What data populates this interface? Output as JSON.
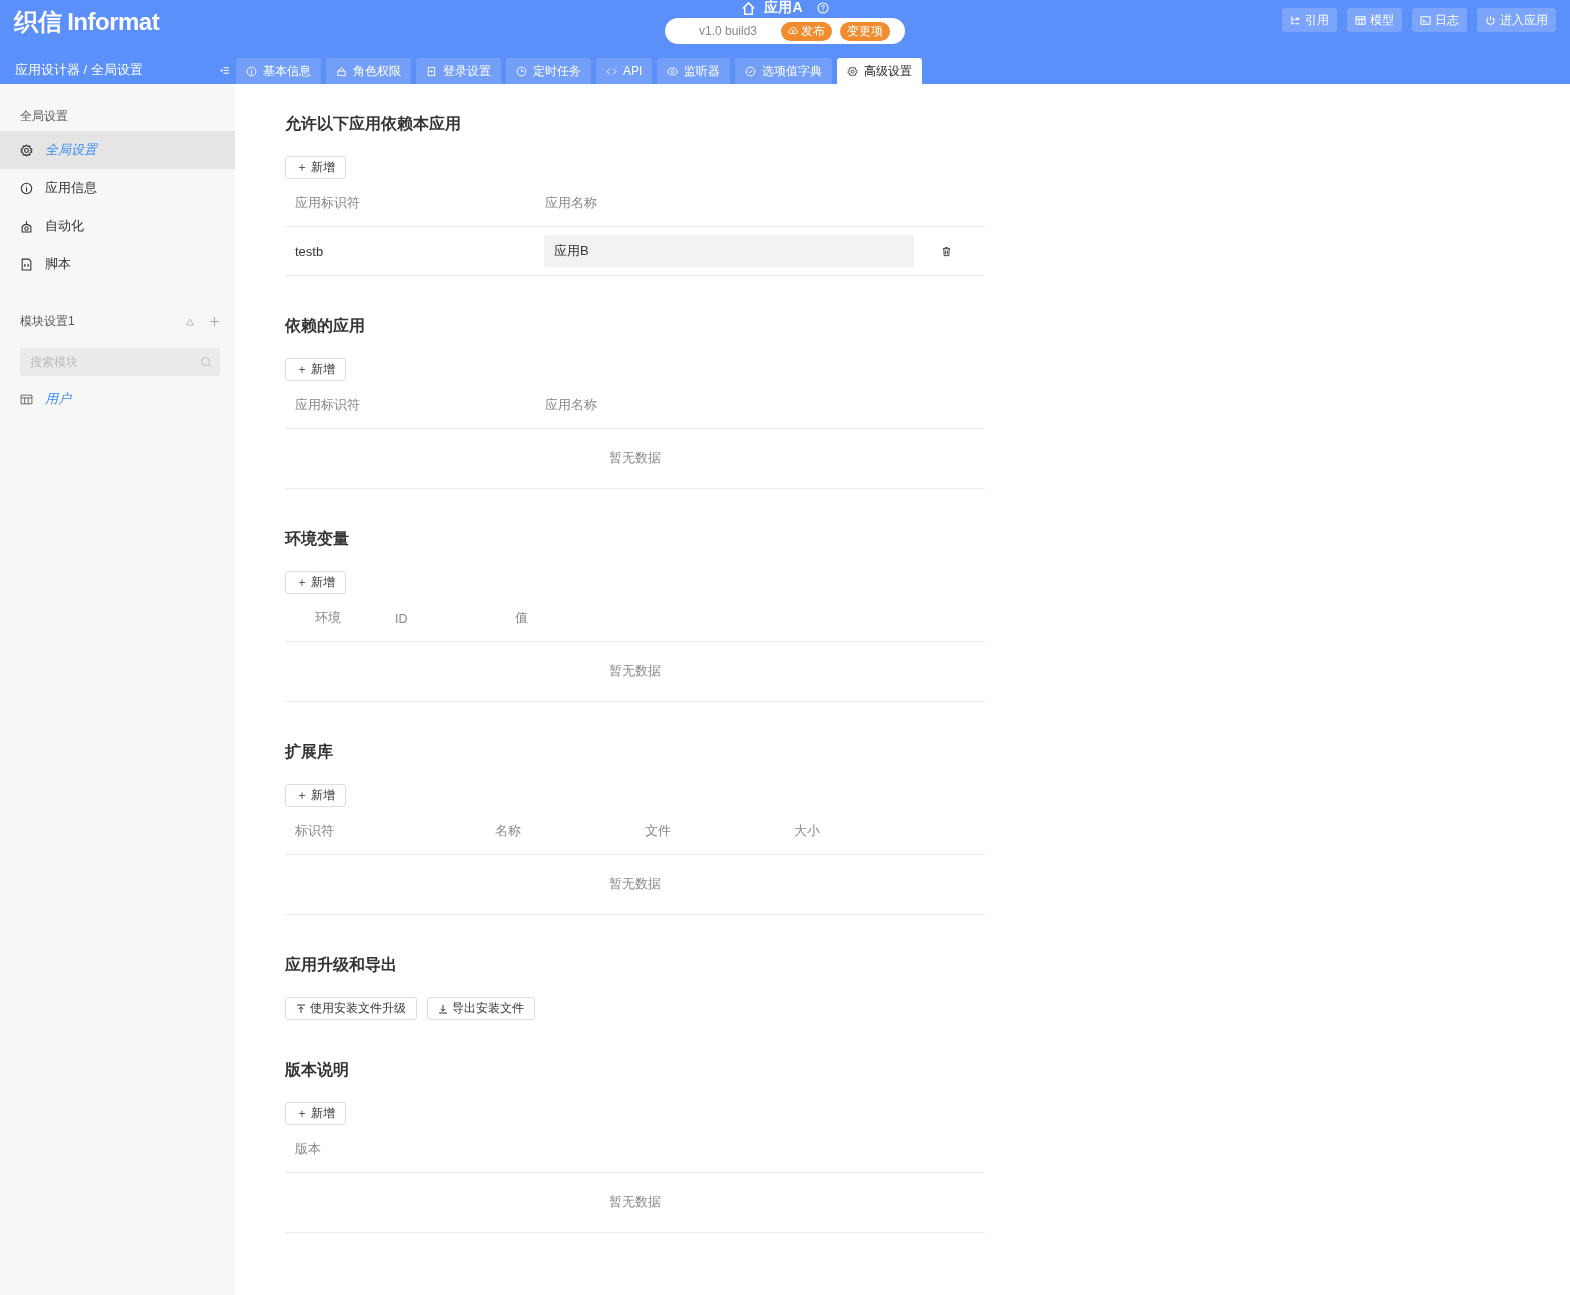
{
  "logo": "织信 Informat",
  "app": {
    "title": "应用A",
    "version": "v1.0 build3",
    "publish": "发布",
    "changes": "变更项"
  },
  "header_buttons": [
    {
      "label": "引用"
    },
    {
      "label": "模型"
    },
    {
      "label": "日志"
    },
    {
      "label": "进入应用"
    }
  ],
  "breadcrumb": "应用设计器 / 全局设置",
  "tabs": [
    {
      "label": "基本信息",
      "selected": false
    },
    {
      "label": "角色权限",
      "selected": false
    },
    {
      "label": "登录设置",
      "selected": false
    },
    {
      "label": "定时任务",
      "selected": false
    },
    {
      "label": "API",
      "selected": false
    },
    {
      "label": "监听器",
      "selected": false
    },
    {
      "label": "选项值字典",
      "selected": false
    },
    {
      "label": "高级设置",
      "selected": true
    }
  ],
  "sidebar": {
    "heading": "全局设置",
    "items": [
      {
        "label": "全局设置",
        "selected": true
      },
      {
        "label": "应用信息",
        "selected": false
      },
      {
        "label": "自动化",
        "selected": false
      },
      {
        "label": "脚本",
        "selected": false
      }
    ],
    "module_heading": "模块设置1",
    "search": {
      "placeholder": "搜索模块"
    },
    "modules": [
      {
        "label": "用户",
        "selected": true
      }
    ]
  },
  "sections": [
    {
      "kind": "table",
      "title": "允许以下应用依赖本应用",
      "add": "＋ 新增",
      "columns": [
        "应用标识符",
        "应用名称"
      ],
      "rows": [
        {
          "id": "testb",
          "name": "应用B"
        }
      ]
    },
    {
      "kind": "table",
      "title": "依赖的应用",
      "add": "＋ 新增",
      "columns": [
        "应用标识符",
        "应用名称"
      ],
      "empty": "暂无数据"
    },
    {
      "kind": "table",
      "title": "环境变量",
      "add": "＋ 新增",
      "columns": [
        "环境",
        "ID",
        "值"
      ],
      "empty": "暂无数据"
    },
    {
      "kind": "table",
      "title": "扩展库",
      "add": "＋ 新增",
      "columns": [
        "标识符",
        "名称",
        "文件",
        "大小"
      ],
      "empty": "暂无数据"
    },
    {
      "kind": "buttons",
      "title": "应用升级和导出",
      "buttons": [
        {
          "label": "使用安装文件升级"
        },
        {
          "label": "导出安装文件"
        }
      ]
    },
    {
      "kind": "table",
      "title": "版本说明",
      "add": "＋ 新增",
      "columns": [
        "版本"
      ],
      "empty": "暂无数据"
    }
  ]
}
